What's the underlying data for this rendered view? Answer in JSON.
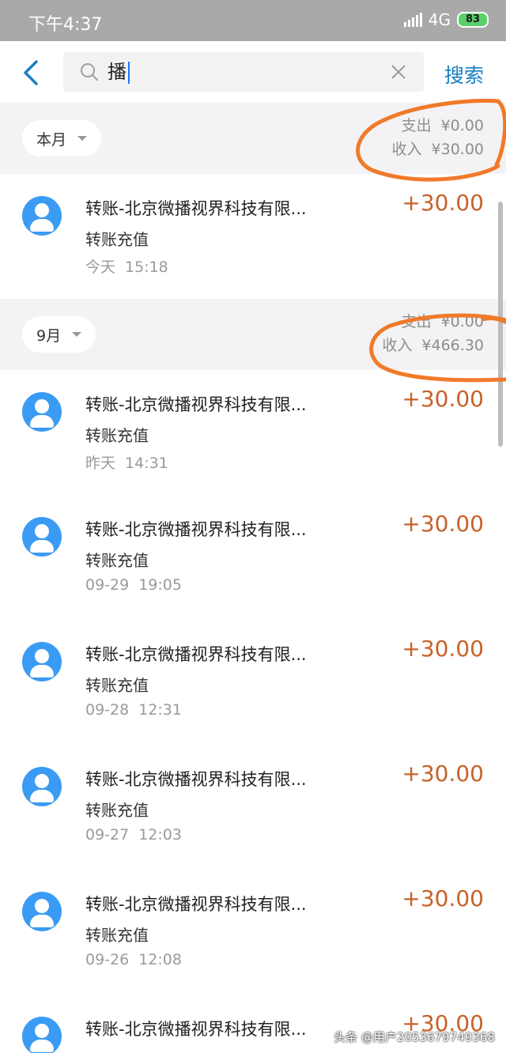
{
  "status_bar": {
    "time": "下午4:37",
    "network": "4G",
    "battery": "83"
  },
  "search": {
    "query": "播",
    "button_label": "搜索"
  },
  "groups": [
    {
      "month": "本月",
      "expense": {
        "label": "支出",
        "amount": "¥0.00"
      },
      "income": {
        "label": "收入",
        "amount": "¥30.00"
      },
      "transactions": [
        {
          "title": "转账-北京微播视界科技有限...",
          "subtitle": "转账充值",
          "date": "今天",
          "time": "15:18",
          "amount": "+30.00"
        }
      ]
    },
    {
      "month": "9月",
      "expense": {
        "label": "支出",
        "amount": "¥0.00"
      },
      "income": {
        "label": "收入",
        "amount": "¥466.30"
      },
      "transactions": [
        {
          "title": "转账-北京微播视界科技有限...",
          "subtitle": "转账充值",
          "date": "昨天",
          "time": "14:31",
          "amount": "+30.00"
        },
        {
          "title": "转账-北京微播视界科技有限...",
          "subtitle": "转账充值",
          "date": "09-29",
          "time": "19:05",
          "amount": "+30.00"
        },
        {
          "title": "转账-北京微播视界科技有限...",
          "subtitle": "转账充值",
          "date": "09-28",
          "time": "12:31",
          "amount": "+30.00"
        },
        {
          "title": "转账-北京微播视界科技有限...",
          "subtitle": "转账充值",
          "date": "09-27",
          "time": "12:03",
          "amount": "+30.00"
        },
        {
          "title": "转账-北京微播视界科技有限...",
          "subtitle": "转账充值",
          "date": "09-26",
          "time": "12:08",
          "amount": "+30.00"
        },
        {
          "title": "转账-北京微播视界科技有限...",
          "subtitle": "",
          "date": "",
          "time": "",
          "amount": "+30.00"
        }
      ]
    }
  ],
  "watermark": "头条 @用户2053679749368",
  "colors": {
    "amount": "#c9622a",
    "accent": "#1a7fc1",
    "avatar": "#3a9bf4",
    "annotation": "#f07a2a"
  }
}
